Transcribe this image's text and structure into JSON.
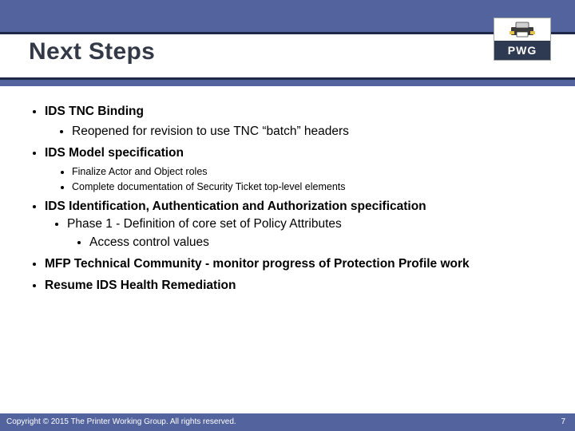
{
  "logo": {
    "label": "PWG"
  },
  "title": "Next Steps",
  "bullets": {
    "b1": "IDS TNC Binding",
    "b1_1": "Reopened for revision to use TNC “batch” headers",
    "b2": "IDS Model specification",
    "b2_1": "Finalize Actor and Object roles",
    "b2_2": "Complete documentation of Security Ticket top-level elements",
    "b3": "IDS Identification, Authentication and Authorization specification",
    "b3_1": "Phase 1 - Definition of core set of Policy Attributes",
    "b3_1_1": "Access control values",
    "b4": "MFP Technical Community - monitor progress of Protection Profile work",
    "b5": "Resume IDS Health Remediation"
  },
  "footer": {
    "copyright": "Copyright © 2015 The Printer Working Group. All rights reserved.",
    "page": "7"
  }
}
